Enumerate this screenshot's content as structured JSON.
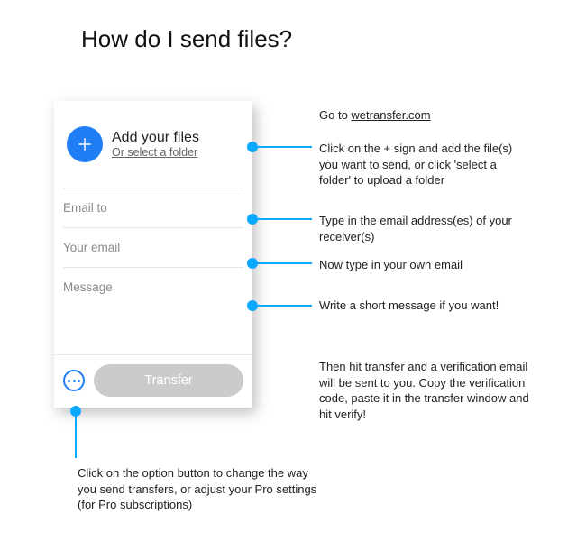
{
  "heading": "How do I send files?",
  "panel": {
    "add_title": "Add your files",
    "add_sub": "Or select a folder",
    "fields": {
      "email_to": "Email to",
      "your_email": "Your email",
      "message": "Message"
    },
    "transfer_label": "Transfer"
  },
  "notes": {
    "goto_prefix": "Go to ",
    "goto_link": "wetransfer.com",
    "add": "Click on the + sign and add the file(s) you want to send, or click 'select a folder' to upload a folder",
    "email_to": "Type in the email address(es) of your receiver(s)",
    "your_email": "Now type in your own email",
    "message": "Write a short message if you want!",
    "transfer": "Then hit transfer and a verification email will be sent to you. Copy the verification code, paste it in the transfer window and hit verify!",
    "option": "Click on the option button to change the way you send transfers, or adjust your Pro settings (for Pro subscriptions)"
  }
}
